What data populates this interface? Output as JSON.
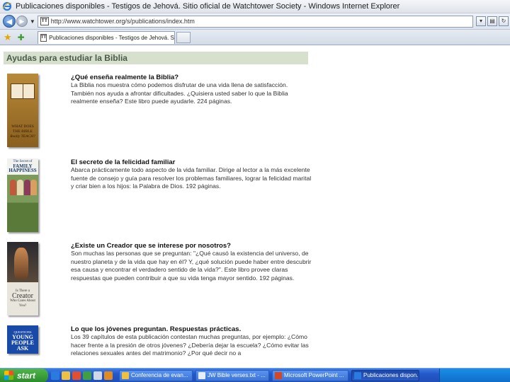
{
  "window": {
    "title": "Publicaciones disponibles - Testigos de Jehová. Sitio oficial de Watchtower Society - Windows Internet Explorer"
  },
  "address_bar": {
    "url": "http://www.watchtower.org/s/publications/index.htm",
    "favicon_text": "TT"
  },
  "tabs": [
    {
      "label": "Publicaciones disponibles - Testigos de Jehová. Sitio o...",
      "favicon_text": "TT"
    }
  ],
  "page": {
    "section_title": "Ayudas para estudiar la Biblia",
    "items": [
      {
        "title": "¿Qué enseña realmente la Biblia?",
        "description": "La Biblia nos muestra cómo podemos disfrutar de una vida llena de satisfacción. También nos ayuda a afrontar dificultades. ¿Quisiera usted saber lo que la Biblia realmente enseña? Este libro puede ayudarle. 224 páginas.",
        "cover_text": [
          "WHAT DOES",
          "THE BIBLE",
          "Really TEACH?"
        ]
      },
      {
        "title": "El secreto de la felicidad familiar",
        "description": "Abarca prácticamente todo aspecto de la vida familiar. Dirige al lector a la más excelente fuente de consejo y guía para resolver los problemas familiares, lograr la felicidad marital y criar bien a los hijos: la Palabra de Dios. 192 páginas.",
        "cover_text": [
          "The Secret of",
          "FAMILY",
          "HAPPINESS"
        ]
      },
      {
        "title": "¿Existe un Creador que se interese por nosotros?",
        "description": "Son muchas las personas que se preguntan: \"¿Qué causó la existencia del universo, de nuestro planeta y de la vida que hay en él? Y, ¿qué solución puede haber entre descubrir esa causa y encontrar el verdadero sentido de la vida?\". Este libro provee claras respuestas que pueden contribuir a que su vida tenga mayor sentido. 192 páginas.",
        "cover_text": [
          "Is There a",
          "Creator",
          "Who Cares About You?"
        ]
      },
      {
        "title": "Lo que los jóvenes preguntan. Respuestas prácticas.",
        "description": "Los 39 capítulos de esta publicación contestan muchas preguntas, por ejemplo: ¿Cómo hacer frente a la presión de otros jóvenes? ¿Debería dejar la escuela? ¿Cómo evitar las relaciones sexuales antes del matrimonio? ¿Por qué decir no a",
        "cover_text": [
          "QUESTIONS",
          "YOUNG",
          "PEOPLE",
          "ASK"
        ]
      }
    ]
  },
  "taskbar": {
    "start_label": "start",
    "buttons": [
      {
        "label": "Conferencia de evan...",
        "active": false
      },
      {
        "label": "JW Bible verses.txt - ...",
        "active": false
      },
      {
        "label": "Microsoft PowerPoint ...",
        "active": false
      },
      {
        "label": "Publicaciones dispon...",
        "active": true
      }
    ]
  },
  "colors": {
    "section_header_bg": "#d6e0cd",
    "section_header_text": "#4a5a4a",
    "taskbar": "#2458c9",
    "start_button": "#2b8a2a"
  }
}
